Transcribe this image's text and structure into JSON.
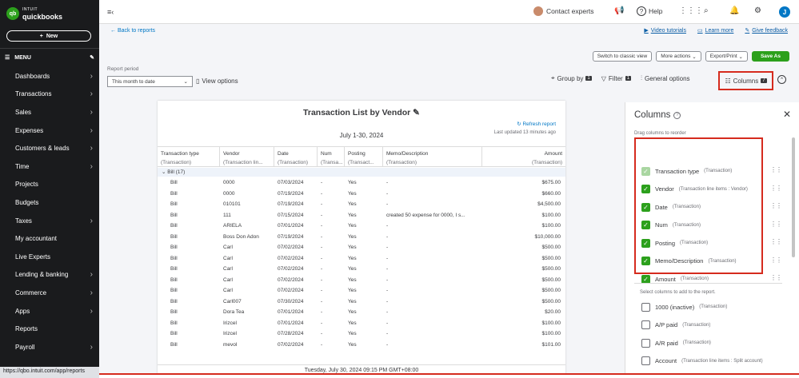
{
  "logo": {
    "brand_small": "INTUIT",
    "brand": "quickbooks",
    "mark": "qb"
  },
  "sidebar": {
    "new_label": "New",
    "menu_label": "MENU",
    "items": [
      {
        "label": "Dashboards",
        "chev": true
      },
      {
        "label": "Transactions",
        "chev": true
      },
      {
        "label": "Sales",
        "chev": true
      },
      {
        "label": "Expenses",
        "chev": true
      },
      {
        "label": "Customers & leads",
        "chev": true
      },
      {
        "label": "Time",
        "chev": true
      },
      {
        "label": "Projects",
        "chev": false
      },
      {
        "label": "Budgets",
        "chev": false
      },
      {
        "label": "Taxes",
        "chev": true
      },
      {
        "label": "My accountant",
        "chev": false
      },
      {
        "label": "Live Experts",
        "chev": false
      },
      {
        "label": "Lending & banking",
        "chev": true
      },
      {
        "label": "Commerce",
        "chev": true
      },
      {
        "label": "Apps",
        "chev": true
      },
      {
        "label": "Reports",
        "chev": false
      },
      {
        "label": "Payroll",
        "chev": true
      }
    ],
    "status_url": "https://qbo.intuit.com/app/reports"
  },
  "topbar": {
    "contact": "Contact experts",
    "help": "Help",
    "user_initial": "J"
  },
  "main": {
    "back": "Back to reports",
    "video": "Video tutorials",
    "learn": "Learn more",
    "feedback": "Give feedback",
    "classic": "Switch to classic view",
    "more_actions": "More actions",
    "export": "Export/Print",
    "save_as": "Save As",
    "report_period_label": "Report period",
    "report_period_value": "This month to date",
    "view_options": "View options",
    "group_by": "Group by",
    "group_by_count": "1",
    "filter": "Filter",
    "filter_count": "1",
    "general_options": "General options",
    "columns": "Columns",
    "columns_count": "7"
  },
  "report": {
    "title": "Transaction List by Vendor",
    "refresh": "Refresh report",
    "date": "July 1-30, 2024",
    "updated": "Last updated 13 minutes ago",
    "headers": [
      {
        "name": "Transaction type",
        "sub": "(Transaction)",
        "w": 78
      },
      {
        "name": "Vendor",
        "sub": "(Transaction lin...",
        "w": 68
      },
      {
        "name": "Date",
        "sub": "(Transaction)",
        "w": 54
      },
      {
        "name": "Num",
        "sub": "(Transa...",
        "w": 34
      },
      {
        "name": "Posting",
        "sub": "(Transact...",
        "w": 48
      },
      {
        "name": "Memo/Description",
        "sub": "(Transaction)",
        "w": 124
      },
      {
        "name": "Amount",
        "sub": "(Transaction)",
        "w": 104
      }
    ],
    "group": "Bill (17)",
    "rows": [
      [
        "Bill",
        "0000",
        "07/03/2024",
        "-",
        "Yes",
        "-",
        "$675.00"
      ],
      [
        "Bill",
        "0000",
        "07/19/2024",
        "-",
        "Yes",
        "-",
        "$660.00"
      ],
      [
        "Bill",
        "010101",
        "07/19/2024",
        "-",
        "Yes",
        "-",
        "$4,500.00"
      ],
      [
        "Bill",
        "111",
        "07/15/2024",
        "-",
        "Yes",
        "created 50 expense for 0000, I s...",
        "$100.00"
      ],
      [
        "Bill",
        "ARIELA",
        "07/01/2024",
        "-",
        "Yes",
        "-",
        "$100.00"
      ],
      [
        "Bill",
        "Boss Don Adon",
        "07/19/2024",
        "-",
        "Yes",
        "-",
        "$10,000.00"
      ],
      [
        "Bill",
        "Carl",
        "07/02/2024",
        "-",
        "Yes",
        "-",
        "$500.00"
      ],
      [
        "Bill",
        "Carl",
        "07/02/2024",
        "-",
        "Yes",
        "-",
        "$500.00"
      ],
      [
        "Bill",
        "Carl",
        "07/02/2024",
        "-",
        "Yes",
        "-",
        "$500.00"
      ],
      [
        "Bill",
        "Carl",
        "07/02/2024",
        "-",
        "Yes",
        "-",
        "$500.00"
      ],
      [
        "Bill",
        "Carl",
        "07/02/2024",
        "-",
        "Yes",
        "-",
        "$500.00"
      ],
      [
        "Bill",
        "Carl007",
        "07/30/2024",
        "-",
        "Yes",
        "-",
        "$500.00"
      ],
      [
        "Bill",
        "Dora Tea",
        "07/01/2024",
        "-",
        "Yes",
        "-",
        "$20.00"
      ],
      [
        "Bill",
        "Irizcel",
        "07/01/2024",
        "-",
        "Yes",
        "-",
        "$100.00"
      ],
      [
        "Bill",
        "Irizcel",
        "07/28/2024",
        "-",
        "Yes",
        "-",
        "$100.00"
      ],
      [
        "Bill",
        "mevol",
        "07/02/2024",
        "-",
        "Yes",
        "-",
        "$101.00"
      ]
    ],
    "footer": "Tuesday, July 30, 2024 09:15 PM GMT+08:00"
  },
  "panel": {
    "title": "Columns",
    "drag_hint": "Drag columns to reorder",
    "selected": [
      {
        "label": "Transaction type",
        "sub": "(Transaction)",
        "disabled": true
      },
      {
        "label": "Vendor",
        "sub": "(Transaction line items : Vendor)",
        "disabled": false
      },
      {
        "label": "Date",
        "sub": "(Transaction)",
        "disabled": false
      },
      {
        "label": "Num",
        "sub": "(Transaction)",
        "disabled": false
      },
      {
        "label": "Posting",
        "sub": "(Transaction)",
        "disabled": false
      },
      {
        "label": "Memo/Description",
        "sub": "(Transaction)",
        "disabled": false
      },
      {
        "label": "Amount",
        "sub": "(Transaction)",
        "disabled": false
      }
    ],
    "add_hint": "Select columns to add to the report.",
    "available": [
      {
        "label": "1000 (inactive)",
        "sub": "(Transaction)"
      },
      {
        "label": "A/P paid",
        "sub": "(Transaction)"
      },
      {
        "label": "A/R paid",
        "sub": "(Transaction)"
      },
      {
        "label": "Account",
        "sub": "(Transaction line items : Split account)"
      }
    ]
  }
}
